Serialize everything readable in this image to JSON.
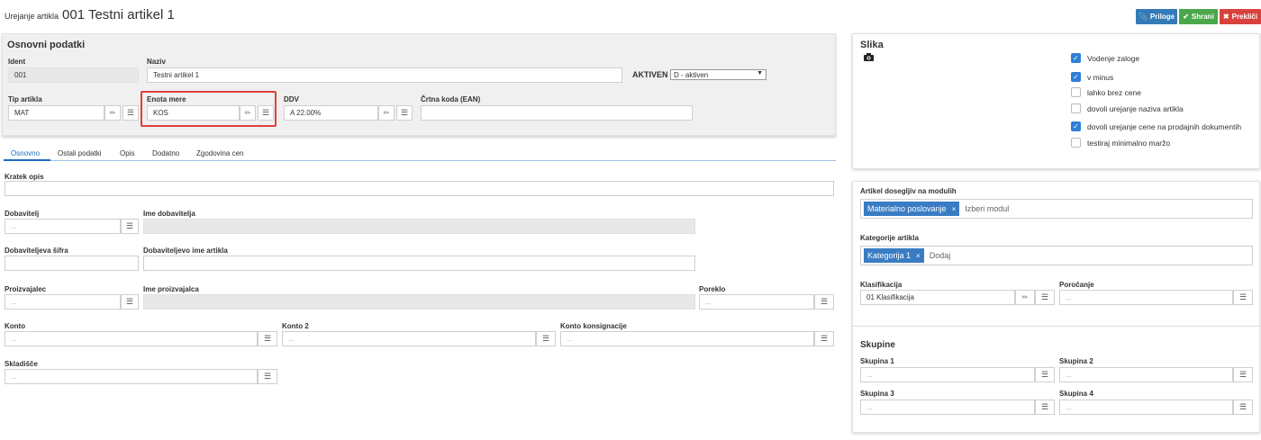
{
  "header": {
    "prefix": "Urejanje artikla",
    "title": "001 Testni artikel 1"
  },
  "actions": {
    "attachments": "Priloge",
    "save": "Shrani",
    "cancel": "Prekliči"
  },
  "basic": {
    "heading": "Osnovni podatki",
    "ident_label": "Ident",
    "ident_value": "001",
    "name_label": "Naziv",
    "name_value": "Testni artikel 1",
    "active_label": "AKTIVEN",
    "active_value": "D - aktiven",
    "type_label": "Tip artikla",
    "type_value": "MAT",
    "unit_label": "Enota mere",
    "unit_value": "KOS",
    "vat_label": "DDV",
    "vat_value": "A 22.00%",
    "ean_label": "Črtna koda (EAN)",
    "ean_value": ""
  },
  "tabs": [
    "Osnovno",
    "Ostali podatki",
    "Opis",
    "Dodatno",
    "Zgodovina cen"
  ],
  "form": {
    "short_desc_label": "Kratek opis",
    "supplier_label": "Dobavitelj",
    "supplier_name_label": "Ime dobavitelja",
    "supplier_code_label": "Dobaviteljeva šifra",
    "supplier_item_label": "Dobaviteljevo ime artikla",
    "producer_label": "Proizvajalec",
    "producer_name_label": "Ime proizvajalca",
    "origin_label": "Poreklo",
    "account_label": "Konto",
    "account2_label": "Konto 2",
    "consign_label": "Konto konsignacije",
    "warehouse_label": "Skladišče",
    "placeholder": "..."
  },
  "image_panel": {
    "heading": "Slika",
    "camera_icon": "camera-icon",
    "checkboxes": [
      {
        "label": "Vodenje zaloge",
        "checked": true
      },
      {
        "label": "v minus",
        "checked": true
      },
      {
        "label": "lahko brez cene",
        "checked": false
      },
      {
        "label": "dovoli urejanje naziva artikla",
        "checked": false
      },
      {
        "label": "dovoli urejanje cene na prodajnih dokumentih",
        "checked": true
      },
      {
        "label": "testiraj minimalno maržo",
        "checked": false
      }
    ]
  },
  "right": {
    "modules_label": "Artikel dosegljiv na modulih",
    "module_chip": "Materialno poslovanje",
    "module_placeholder": "Izberi modul",
    "categories_label": "Kategorije artikla",
    "category_chip": "Kategorija 1",
    "category_placeholder": "Dodaj",
    "classification_label": "Klasifikacija",
    "classification_value": "01 Klasifikacija",
    "reporting_label": "Poročanje",
    "groups_heading": "Skupine",
    "group1_label": "Skupina 1",
    "group2_label": "Skupina 2",
    "group3_label": "Skupina 3",
    "group4_label": "Skupina 4",
    "placeholder": "..."
  },
  "colors": {
    "primary": "#337ab7",
    "success": "#4aa84a",
    "danger": "#d9423c",
    "highlight": "#e0403a",
    "chip": "#3a7cc4"
  }
}
